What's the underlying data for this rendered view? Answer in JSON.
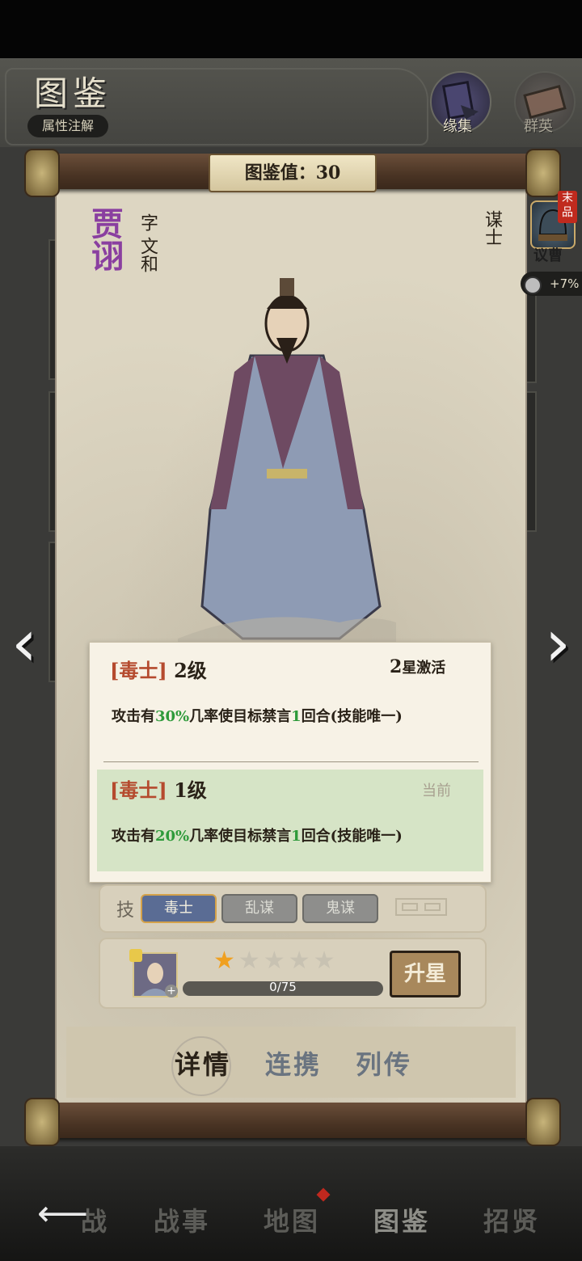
{
  "header": {
    "title": "图鉴",
    "attr_button": "属性注解",
    "yuanji_label": "缘集",
    "qunying_label": "群英"
  },
  "scroll": {
    "score_label": "图鉴值：30"
  },
  "hero": {
    "name": "贾诩",
    "zi_label": "字 文和",
    "class_label": "谋士",
    "badge_name": "议曹",
    "badge_tag": "末品",
    "bonus": "+7%"
  },
  "skill_next": {
    "name": "毒士",
    "level": "2级",
    "req_num": "2",
    "req_text": "星激活",
    "desc_pre": "攻击有",
    "desc_pct": "30%",
    "desc_mid": "几率使目标禁言",
    "desc_num": "1",
    "desc_post": "回合(技能唯一)"
  },
  "skill_current": {
    "name": "毒士",
    "level": "1级",
    "tag": "当前",
    "desc_pre": "攻击有",
    "desc_pct": "20%",
    "desc_mid": "几率使目标禁言",
    "desc_num": "1",
    "desc_post": "回合(技能唯一)"
  },
  "skill_tabs": {
    "label": "技",
    "items": [
      "毒士",
      "乱谋",
      "鬼谋"
    ]
  },
  "stars": {
    "filled": 1,
    "total": 5,
    "progress_text": "0/75",
    "progress_fraction": 0,
    "upgrade_label": "升星"
  },
  "bottom_tabs": [
    "详情",
    "连携",
    "列传"
  ],
  "nav": {
    "items": [
      "战",
      "战事",
      "地图",
      "图鉴",
      "招贤"
    ]
  },
  "colors": {
    "name_purple": "#8a3fa0",
    "highlight_green": "#2e9a3a",
    "bracket_red": "#b54a2e",
    "star_gold": "#f0a020"
  }
}
